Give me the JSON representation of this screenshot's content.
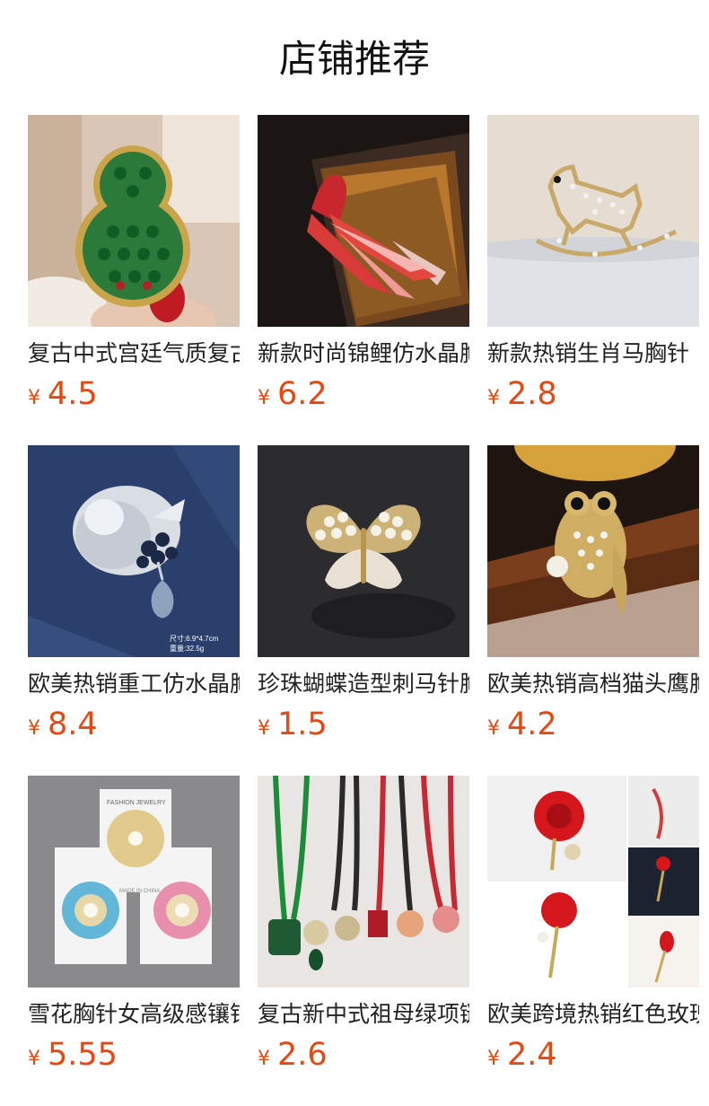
{
  "header": {
    "title": "店铺推荐"
  },
  "currency_symbol": "¥",
  "products": [
    {
      "title": "复古中式宫廷气质复古葫芦胸针",
      "price": "4.5"
    },
    {
      "title": "新款时尚锦鲤仿水晶胸针",
      "price": "6.2"
    },
    {
      "title": "新款热销生肖马胸针",
      "price": "2.8"
    },
    {
      "title": "欧美热销重工仿水晶胸针",
      "price": "8.4"
    },
    {
      "title": "珍珠蝴蝶造型刺马针胸针",
      "price": "1.5"
    },
    {
      "title": "欧美热销高档猫头鹰胸针",
      "price": "4.2"
    },
    {
      "title": "雪花胸针女高级感镶钻",
      "price": "5.55"
    },
    {
      "title": "复古新中式祖母绿项链",
      "price": "2.6"
    },
    {
      "title": "欧美跨境热销红色玫瑰胸针",
      "price": "2.4"
    }
  ],
  "image_texts": {
    "size_label": "尺寸:6.9*4.7cm",
    "weight_label": "重量:32.5g",
    "card_brand": "FASHION JEWELRY",
    "card_origin": "MADE IN CHINA"
  }
}
